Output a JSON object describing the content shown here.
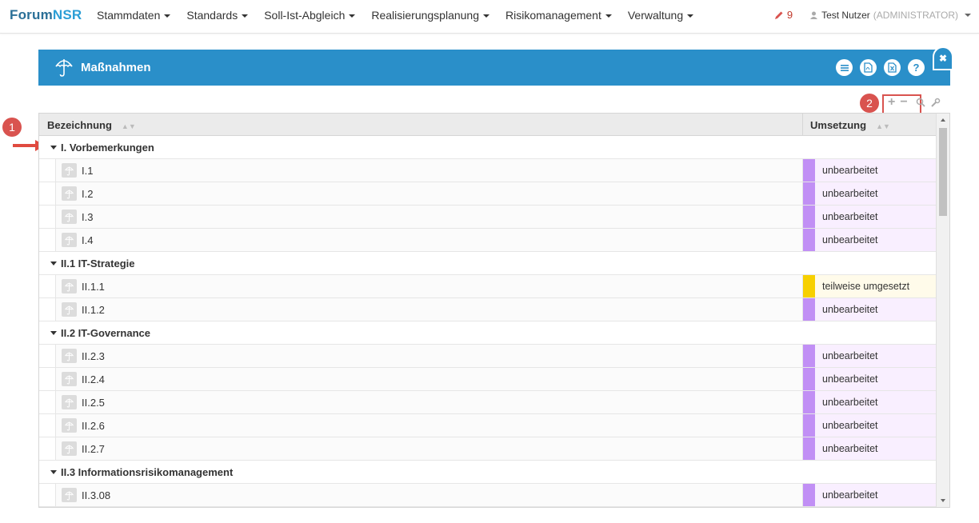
{
  "brand": {
    "part1": "Forum",
    "part2": "NSR"
  },
  "nav": {
    "items": [
      {
        "label": "Stammdaten"
      },
      {
        "label": "Standards"
      },
      {
        "label": "Soll-Ist-Abgleich"
      },
      {
        "label": "Realisierungsplanung"
      },
      {
        "label": "Risikomanagement"
      },
      {
        "label": "Verwaltung"
      }
    ],
    "tasks_count": "9",
    "user_name": "Test Nutzer",
    "user_role": "(ADMINISTRATOR)"
  },
  "panel": {
    "title": "Maßnahmen",
    "buttons": [
      "list-icon",
      "pdf-icon",
      "excel-icon",
      "help-icon"
    ],
    "help_label": "?"
  },
  "annotations": {
    "badge1": "1",
    "badge2": "2"
  },
  "grid": {
    "col_name": "Bezeichnung",
    "col_status": "Umsetzung",
    "groups": [
      {
        "label": "I. Vorbemerkungen",
        "items": [
          {
            "label": "I.1",
            "status": "unbearbeitet"
          },
          {
            "label": "I.2",
            "status": "unbearbeitet"
          },
          {
            "label": "I.3",
            "status": "unbearbeitet"
          },
          {
            "label": "I.4",
            "status": "unbearbeitet"
          }
        ]
      },
      {
        "label": "II.1 IT-Strategie",
        "items": [
          {
            "label": "II.1.1",
            "status": "teilweise umgesetzt"
          },
          {
            "label": "II.1.2",
            "status": "unbearbeitet"
          }
        ]
      },
      {
        "label": "II.2 IT-Governance",
        "items": [
          {
            "label": "II.2.3",
            "status": "unbearbeitet"
          },
          {
            "label": "II.2.4",
            "status": "unbearbeitet"
          },
          {
            "label": "II.2.5",
            "status": "unbearbeitet"
          },
          {
            "label": "II.2.6",
            "status": "unbearbeitet"
          },
          {
            "label": "II.2.7",
            "status": "unbearbeitet"
          }
        ]
      },
      {
        "label": "II.3 Informationsrisikomanagement",
        "items": [
          {
            "label": "II.3.08",
            "status": "unbearbeitet"
          },
          {
            "label": "",
            "status": ""
          }
        ]
      }
    ]
  },
  "status_colors": {
    "unbearbeitet": {
      "bar": "#c18ff5",
      "bg": "#f9efff"
    },
    "teilweise umgesetzt": {
      "bar": "#f7d000",
      "bg": "#fffbea"
    }
  }
}
